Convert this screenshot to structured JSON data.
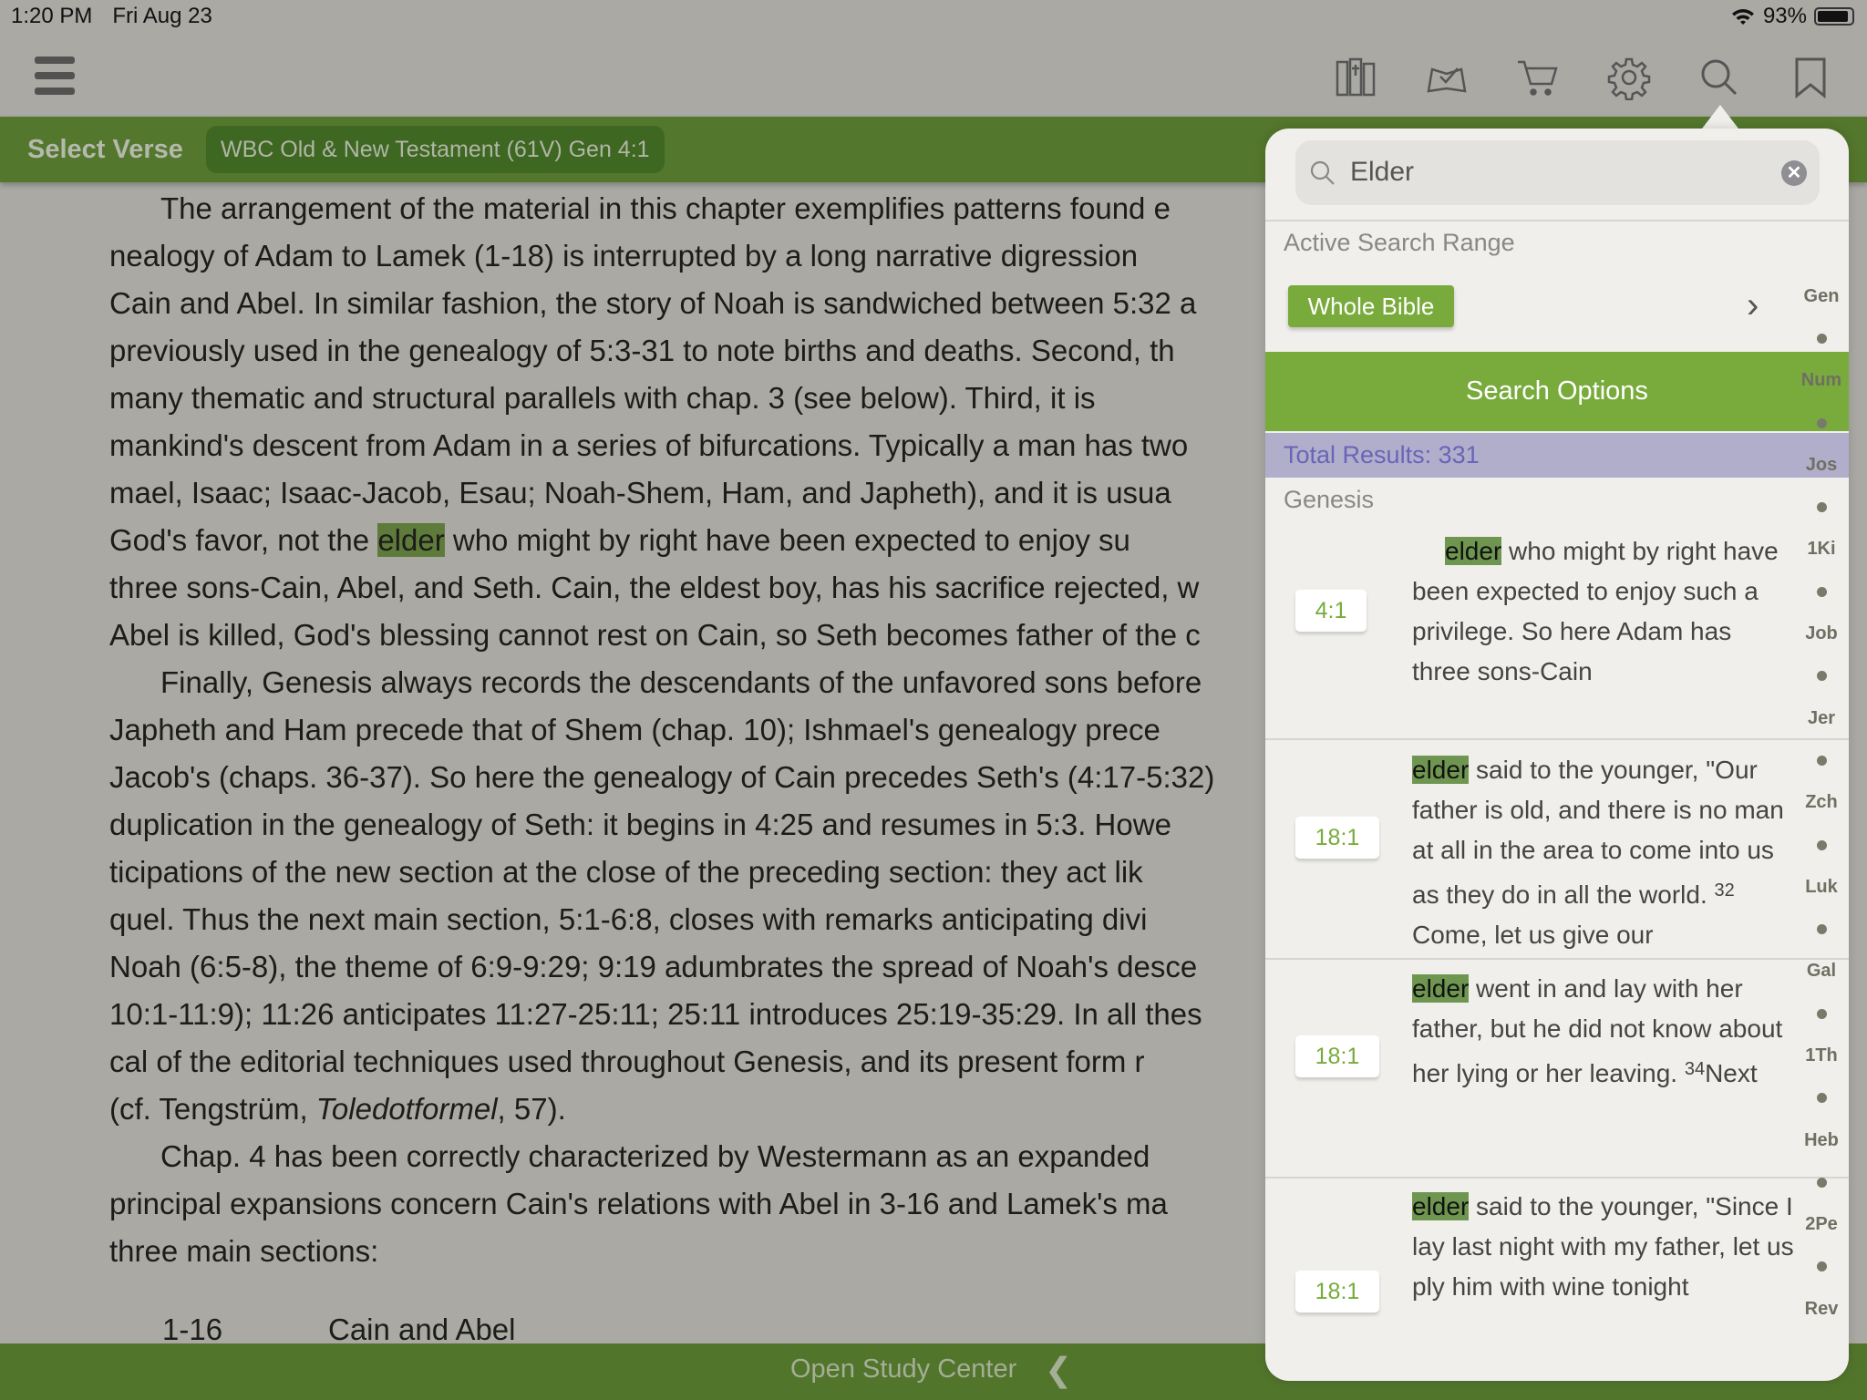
{
  "status": {
    "time": "1:20 PM",
    "date": "Fri Aug 23",
    "battery": "93%",
    "battery_level": 0.93
  },
  "toolbar": {
    "icons": [
      "library-icon",
      "reading-plan-icon",
      "cart-icon",
      "gear-icon",
      "search-icon",
      "bookmark-icon"
    ]
  },
  "header": {
    "select_verse": "Select Verse",
    "resource": "WBC Old & New Testament (61V) Gen 4:1"
  },
  "main": {
    "lines": [
      {
        "indent": true,
        "segs": [
          {
            "t": "The arrangement of the material in this chapter exemplifies patterns found e"
          }
        ]
      },
      {
        "segs": [
          {
            "t": "nealogy of Adam to Lamek (1-18) is interrupted by a long narrative digression"
          }
        ]
      },
      {
        "segs": [
          {
            "t": "Cain and Abel. In similar fashion, the story of Noah is sandwiched between 5:32 a"
          }
        ]
      },
      {
        "segs": [
          {
            "t": "previously used in the genealogy of 5:3-31 to note births and deaths. Second, th"
          }
        ]
      },
      {
        "segs": [
          {
            "t": "many thematic and structural parallels with chap. 3 (see below). Third, it is"
          }
        ]
      },
      {
        "segs": [
          {
            "t": "mankind's descent from Adam in a series of bifurcations. Typically a man has two"
          }
        ]
      },
      {
        "segs": [
          {
            "t": "mael, Isaac; Isaac-Jacob, Esau; Noah-Shem, Ham, and Japheth), and it is usua"
          }
        ]
      },
      {
        "segs": [
          {
            "t": "God's favor, not the "
          },
          {
            "t": "elder",
            "s": "hl"
          },
          {
            "t": " who might by right have been expected to enjoy su"
          }
        ]
      },
      {
        "segs": [
          {
            "t": "three sons-Cain, Abel, and Seth. Cain, the eldest boy, has his sacrifice rejected, w"
          }
        ]
      },
      {
        "segs": [
          {
            "t": "Abel is killed, God's blessing cannot rest on Cain, so Seth becomes father of the c"
          }
        ]
      },
      {
        "indent": true,
        "segs": [
          {
            "t": "Finally, Genesis always records the descendants of the unfavored sons before"
          }
        ]
      },
      {
        "segs": [
          {
            "t": "Japheth and Ham precede that of Shem (chap. 10); Ishmael's genealogy prece"
          }
        ]
      },
      {
        "segs": [
          {
            "t": "Jacob's (chaps. 36-37). So here the genealogy of Cain precedes Seth's (4:17-5:32)"
          }
        ]
      },
      {
        "segs": [
          {
            "t": "duplication in the genealogy of Seth: it begins in 4:25 and resumes in 5:3. Howe"
          }
        ]
      },
      {
        "segs": [
          {
            "t": "ticipations of the new section at the close of the preceding section: they act lik"
          }
        ]
      },
      {
        "segs": [
          {
            "t": "quel. Thus the next main section, 5:1-6:8, closes with remarks anticipating divi"
          }
        ]
      },
      {
        "segs": [
          {
            "t": "Noah (6:5-8), the theme of 6:9-9:29; 9:19 adumbrates the spread of Noah's desce"
          }
        ]
      },
      {
        "segs": [
          {
            "t": "10:1-11:9); 11:26 anticipates 11:27-25:11; 25:11 introduces 25:19-35:29. In all thes"
          }
        ]
      },
      {
        "segs": [
          {
            "t": "cal of the editorial techniques used throughout Genesis, and its present form r"
          }
        ]
      },
      {
        "segs": [
          {
            "t": "(cf. Tengstrüm, "
          },
          {
            "t": "Toledotformel",
            "s": "it"
          },
          {
            "t": ", 57)."
          }
        ]
      },
      {
        "indent": true,
        "segs": [
          {
            "t": "Chap. 4 has been correctly characterized by Westermann as an expanded"
          }
        ]
      },
      {
        "segs": [
          {
            "t": "principal expansions concern Cain's relations with Abel in 3-16 and Lamek's ma"
          }
        ]
      },
      {
        "segs": [
          {
            "t": "three main sections:"
          }
        ]
      }
    ],
    "outline": {
      "range": "1-16",
      "title": "Cain and Abel"
    }
  },
  "footer": {
    "open_study_center": "Open Study Center",
    "chevron": "❮"
  },
  "search": {
    "query": "Elder",
    "active_range_label": "Active Search Range",
    "range_button": "Whole Bible",
    "options_label": "Search Options",
    "total_results": "Total Results: 331",
    "book_header": "Genesis",
    "results": [
      {
        "ref": "4:1",
        "hl": "elder",
        "text": " who might by right have been expected to enjoy such a privilege. So here Adam has three sons-Cain",
        "indent": true
      },
      {
        "ref": "18:1",
        "hl": "elder",
        "text": " said to the younger, \"Our father is old, and there is no man at all in the area to come into us as they do in all the world. ",
        "sup": "32",
        "after": " Come, let us give our"
      },
      {
        "ref": "18:1",
        "hl": "elder",
        "text": " went in and lay with her father, but he did not know about her lying or her leaving. ",
        "sup": "34",
        "after": "Next"
      },
      {
        "ref": "18:1",
        "hl": "elder",
        "text": " said to the younger, \"Since I lay last night with my father, let us ply him with wine tonight"
      }
    ],
    "book_index": [
      "Gen",
      "Num",
      "Jos",
      "1Ki",
      "Job",
      "Jer",
      "Zch",
      "Luk",
      "Gal",
      "1Th",
      "Heb",
      "2Pe",
      "Rev"
    ]
  },
  "colors": {
    "accent_green": "#79ab3c",
    "bar_green": "#53772c",
    "highlight": "#6f9650",
    "results_band": "#b1aecb"
  }
}
